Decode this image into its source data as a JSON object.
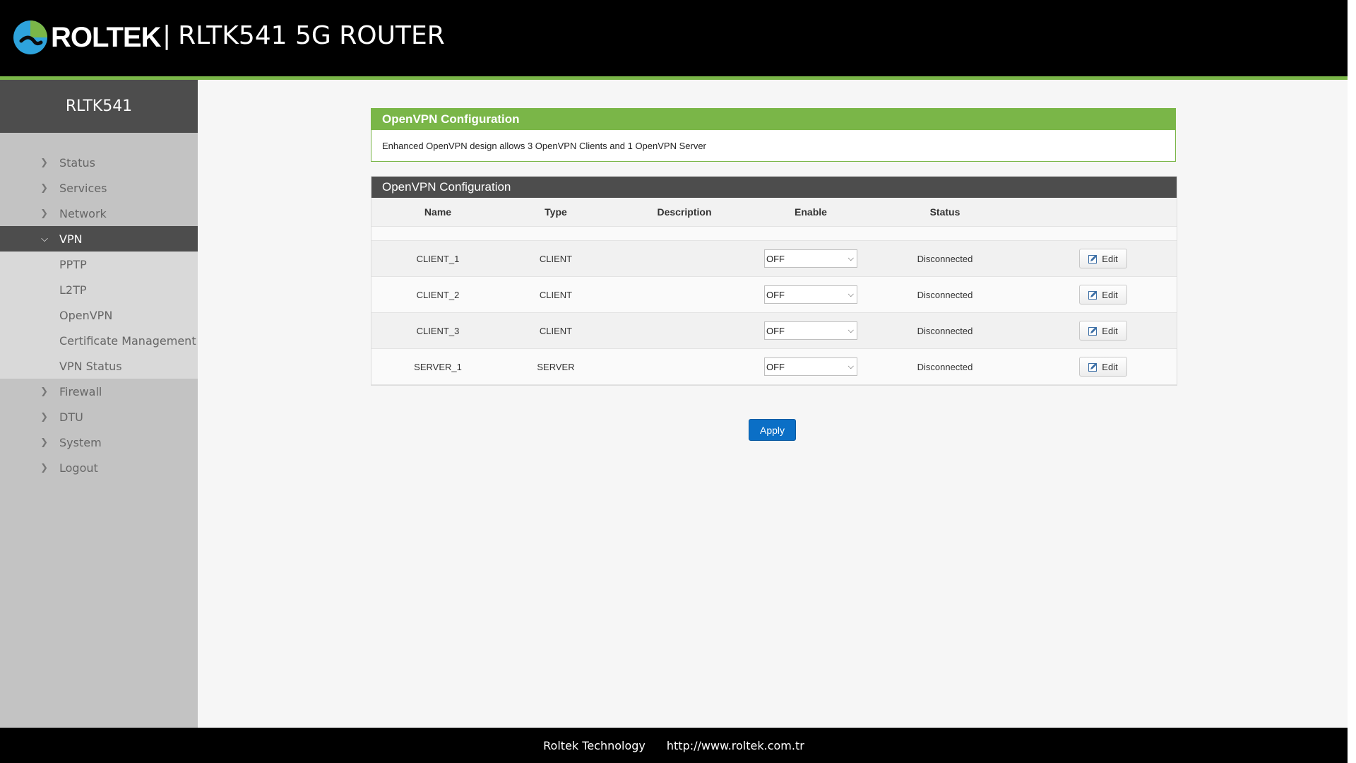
{
  "header": {
    "brand": "ROLTEK",
    "separator": "|",
    "model_title": "RLTK541  5G  ROUTER"
  },
  "sidebar": {
    "title": "RLTK541",
    "items": [
      {
        "label": "Status"
      },
      {
        "label": "Services"
      },
      {
        "label": "Network"
      },
      {
        "label": "VPN",
        "expanded": true
      },
      {
        "label": "Firewall"
      },
      {
        "label": "DTU"
      },
      {
        "label": "System"
      },
      {
        "label": "Logout"
      }
    ],
    "vpn_sub": [
      {
        "label": "PPTP"
      },
      {
        "label": "L2TP"
      },
      {
        "label": "OpenVPN"
      },
      {
        "label": "Certificate Management"
      },
      {
        "label": "VPN Status"
      }
    ]
  },
  "info_panel": {
    "title": "OpenVPN Configuration",
    "text": "Enhanced OpenVPN design allows 3 OpenVPN Clients and 1 OpenVPN Server"
  },
  "table": {
    "title": "OpenVPN Configuration",
    "columns": [
      "Name",
      "Type",
      "Description",
      "Enable",
      "Status"
    ],
    "rows": [
      {
        "name": "CLIENT_1",
        "type": "CLIENT",
        "description": "",
        "enable": "OFF",
        "status": "Disconnected",
        "action": "Edit"
      },
      {
        "name": "CLIENT_2",
        "type": "CLIENT",
        "description": "",
        "enable": "OFF",
        "status": "Disconnected",
        "action": "Edit"
      },
      {
        "name": "CLIENT_3",
        "type": "CLIENT",
        "description": "",
        "enable": "OFF",
        "status": "Disconnected",
        "action": "Edit"
      },
      {
        "name": "SERVER_1",
        "type": "SERVER",
        "description": "",
        "enable": "OFF",
        "status": "Disconnected",
        "action": "Edit"
      }
    ]
  },
  "apply_label": "Apply",
  "footer": {
    "company": "Roltek Technology",
    "url": "http://www.roltek.com.tr"
  },
  "colors": {
    "accent_green": "#7ab648",
    "header_bg": "#000000",
    "dark_gray": "#4d4d4d",
    "button_blue": "#0b6fc6"
  }
}
